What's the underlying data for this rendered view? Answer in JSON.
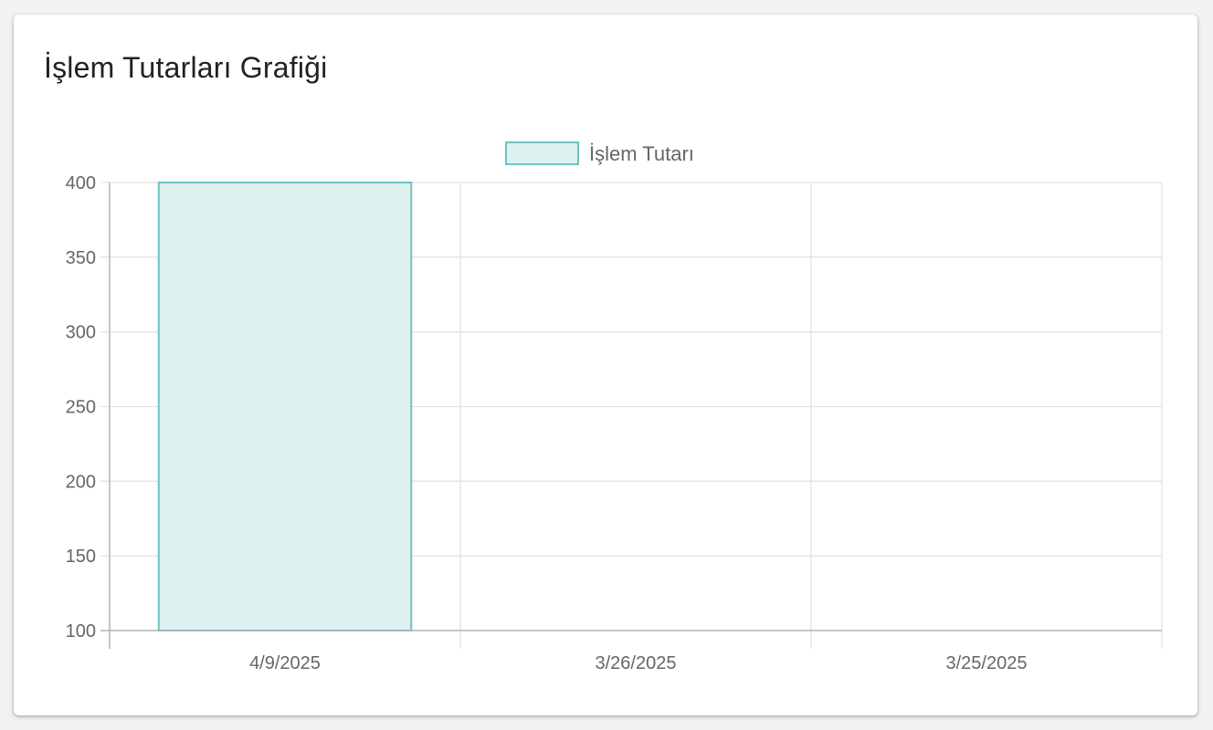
{
  "card": {
    "title": "İşlem Tutarları Grafiği"
  },
  "colors": {
    "bar_fill": "#dff0f0",
    "bar_stroke": "#6ec3c4",
    "grid": "#e2e2e2",
    "axis": "#b4b4b4"
  },
  "chart_data": {
    "type": "bar",
    "categories": [
      "4/9/2025",
      "3/26/2025",
      "3/25/2025"
    ],
    "series": [
      {
        "name": "İşlem Tutarı",
        "values": [
          400,
          100,
          100
        ]
      }
    ],
    "ylim": [
      100,
      400
    ],
    "yticks": [
      100,
      150,
      200,
      250,
      300,
      350,
      400
    ],
    "grid": true,
    "legend_position": "top-center",
    "xlabel": "",
    "ylabel": ""
  }
}
